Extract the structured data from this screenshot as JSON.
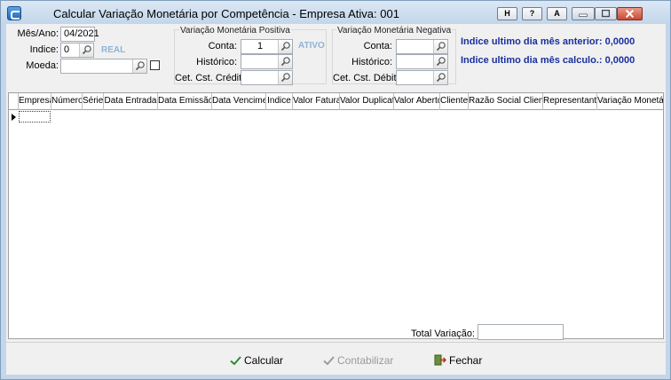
{
  "window": {
    "title": "Calcular Variação Monetária por Competência - Empresa Ativa: 001",
    "buttons": {
      "h": "H",
      "help": "?",
      "a": "A"
    }
  },
  "filters": {
    "mes_ano_label": "Mês/Ano:",
    "mes_ano_value": "04/2021",
    "indice_label": "Indice:",
    "indice_value": "0",
    "indice_tag": "REAL",
    "moeda_label": "Moeda:",
    "moeda_value": ""
  },
  "positiva": {
    "title": "Variação Monetária Positiva",
    "conta_label": "Conta:",
    "conta_value": "1",
    "conta_tag": "ATIVO",
    "historico_label": "Histórico:",
    "historico_value": "",
    "cet_label": "Cet. Cst. Crédito:",
    "cet_value": ""
  },
  "negativa": {
    "title": "Variação Monetária Negativa",
    "conta_label": "Conta:",
    "conta_value": "",
    "historico_label": "Histórico:",
    "historico_value": "",
    "cet_label": "Cet. Cst. Débito:",
    "cet_value": ""
  },
  "info": {
    "anterior": "Indice ultimo dia mês anterior: 0,0000",
    "calculo": "Indice ultimo dia mês calculo.: 0,0000"
  },
  "grid": {
    "columns": [
      "Empresa",
      "Número",
      "Série",
      "Data Entrada",
      "Data Emissão",
      "Data Vencimen",
      "Indice",
      "Valor Fatura",
      "Valor Duplicata",
      "Valor Aberto",
      "Cliente",
      "Razão Social Cliente",
      "Representante",
      "Variação Monetária"
    ]
  },
  "footer": {
    "total_label": "Total Variação:",
    "total_value": "",
    "calcular": "Calcular",
    "contabilizar": "Contabilizar",
    "fechar": "Fechar"
  },
  "colors": {
    "info_text": "#1a2f9c",
    "tag_text": "#8fb3d6",
    "window_frame": "#c4d6ea"
  }
}
